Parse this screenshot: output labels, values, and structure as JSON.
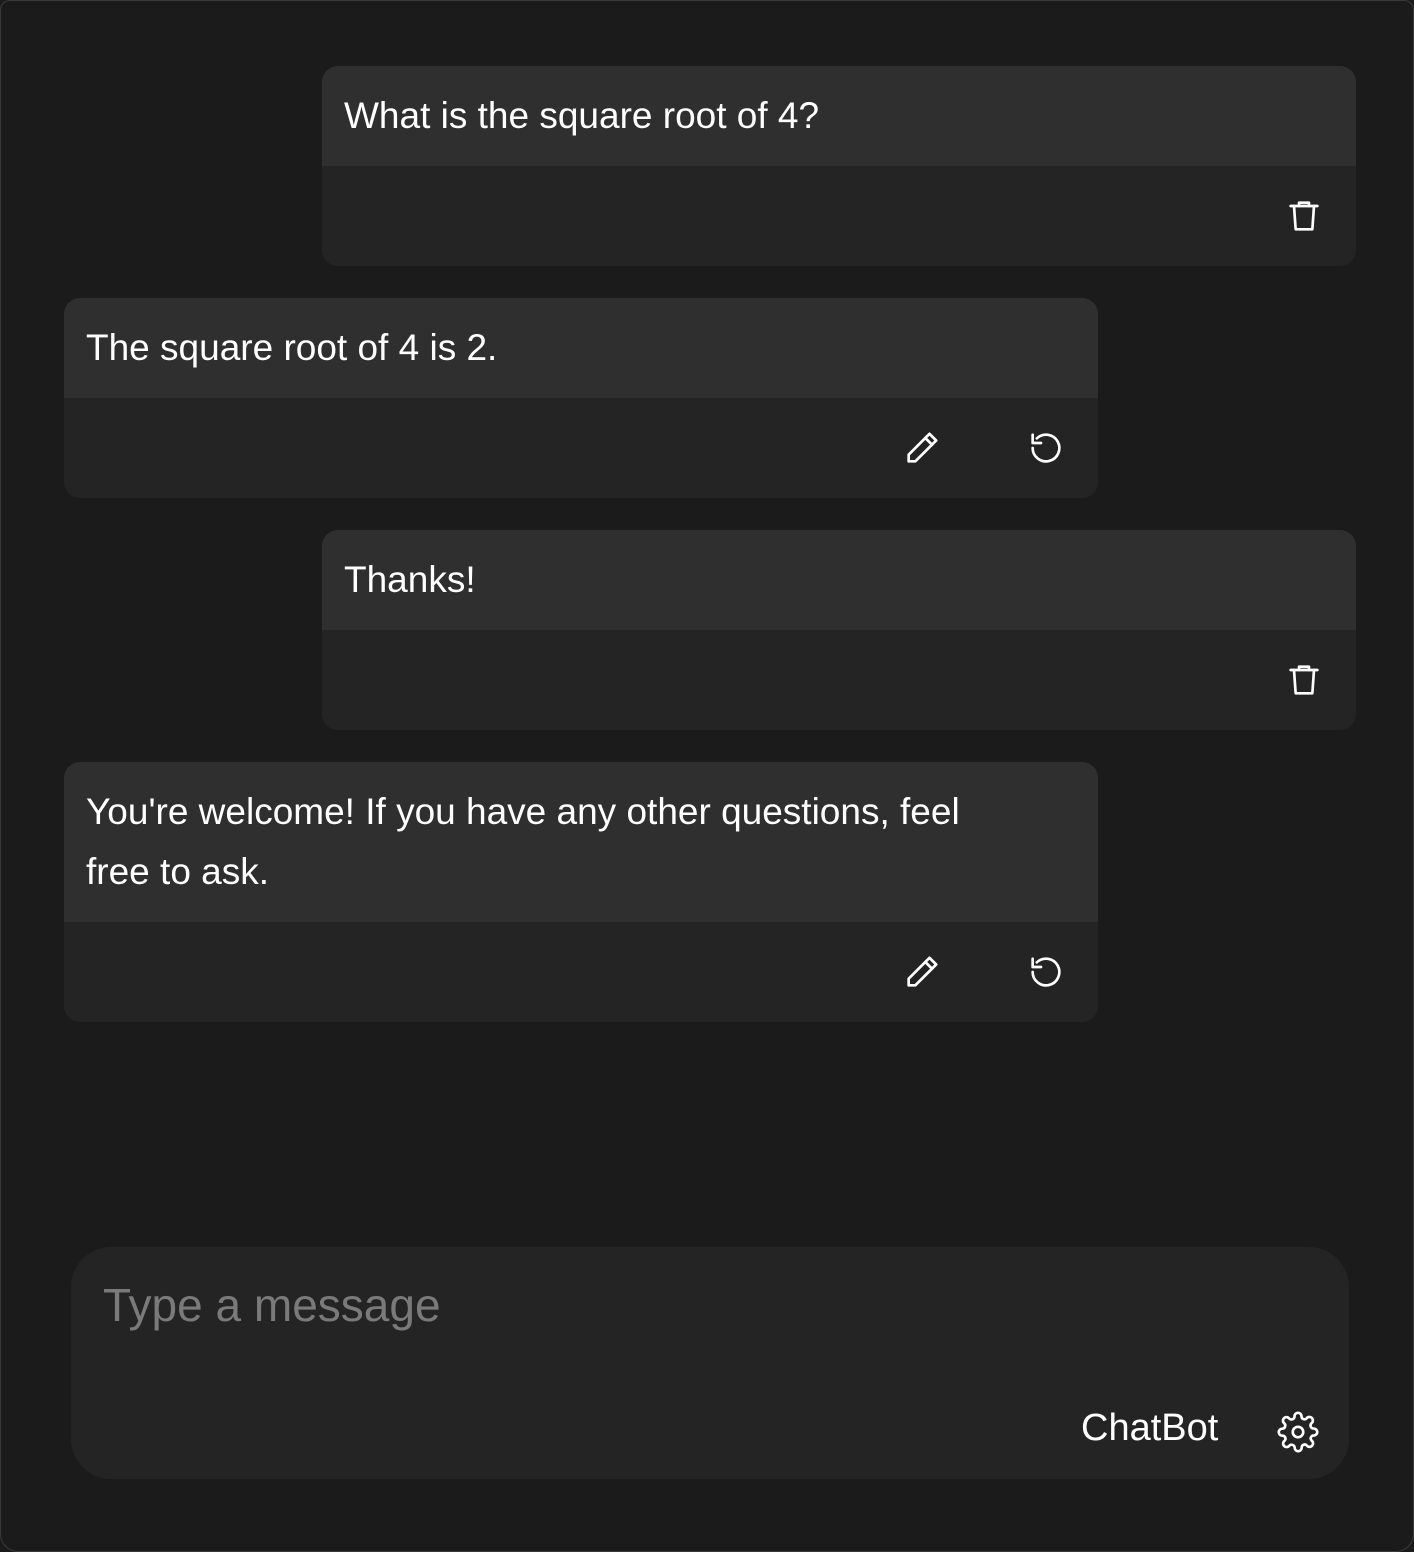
{
  "messages": [
    {
      "role": "user",
      "text": "What is the square root of 4?",
      "actions": [
        "trash-icon"
      ]
    },
    {
      "role": "bot",
      "text": "The square root of 4 is 2.",
      "actions": [
        "pencil-icon",
        "refresh-icon"
      ]
    },
    {
      "role": "user",
      "text": "Thanks!",
      "actions": [
        "trash-icon"
      ]
    },
    {
      "role": "bot",
      "text": "You're welcome! If you have any other questions, feel free to ask.",
      "actions": [
        "pencil-icon",
        "refresh-icon"
      ]
    }
  ],
  "composer": {
    "placeholder": "Type a message",
    "value": "",
    "model_name": "ChatBot",
    "settings_icon": "gear-icon"
  },
  "colors": {
    "background": "#1b1b1b",
    "bubble_header": "#2f2f2f",
    "bubble_footer": "#242424",
    "text": "#ffffff",
    "placeholder": "#7a7a7a"
  }
}
